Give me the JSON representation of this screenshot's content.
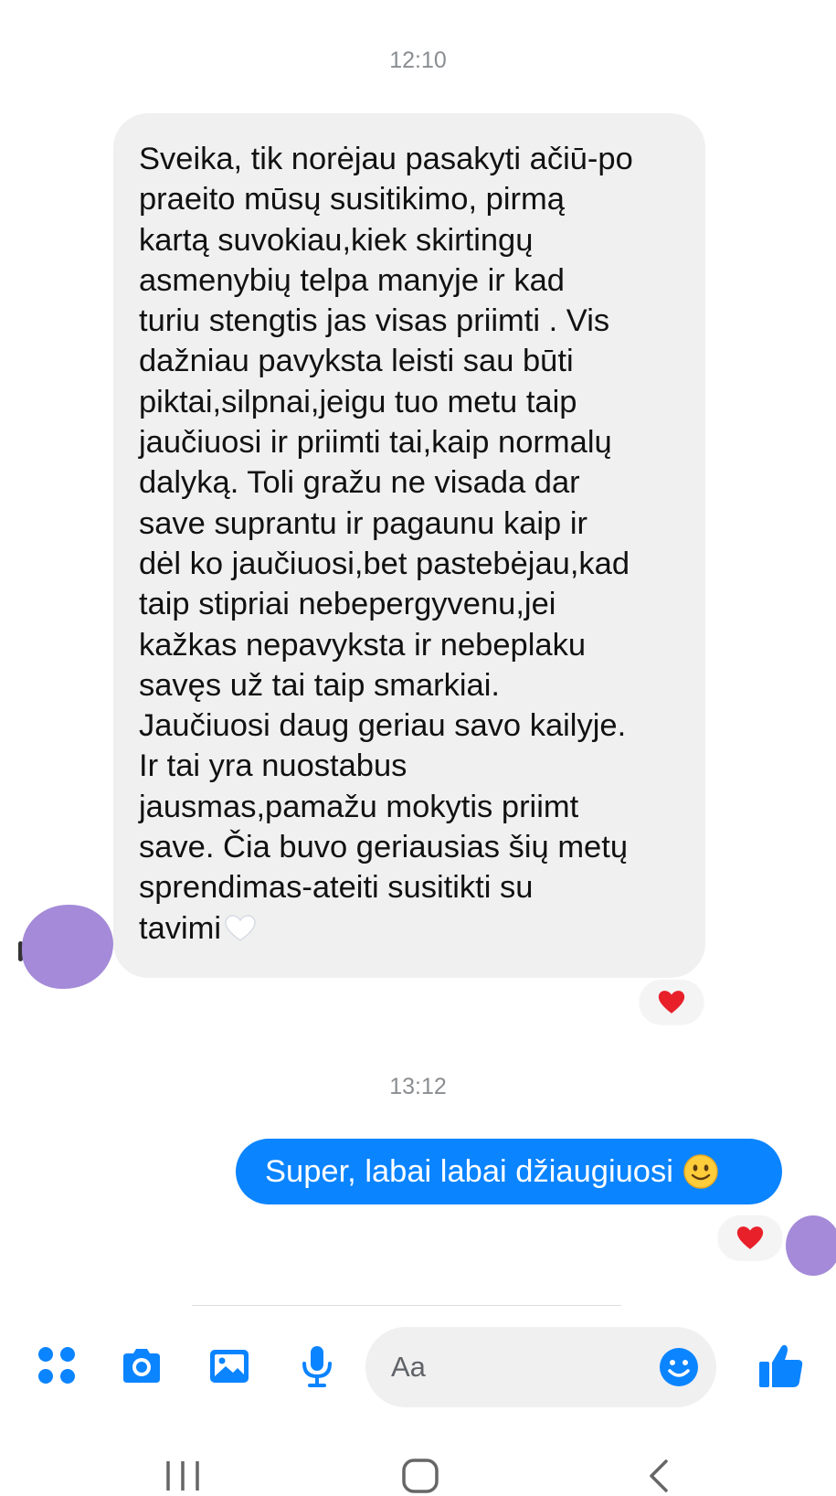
{
  "conversation": {
    "timestamp_1": "12:10",
    "timestamp_2": "13:12",
    "incoming_message": {
      "lines": [
        "Sveika, tik norėjau pasakyti ačiū-po",
        "praeito mūsų susitikimo, pirmą",
        "kartą suvokiau,kiek skirtingų",
        "asmenybių telpa manyje ir kad",
        "turiu stengtis jas visas priimti . Vis",
        "dažniau pavyksta leisti sau būti",
        "piktai,silpnai,jeigu tuo metu taip",
        "jaučiuosi ir priimti tai,kaip normalų",
        "dalyką. Toli gražu ne visada dar",
        "save suprantu ir pagaunu kaip ir",
        "dėl ko jaučiuosi,bet pastebėjau,kad",
        "taip stipriai nebepergyvenu,jei",
        "kažkas nepavyksta ir nebeplaku",
        "savęs už tai taip smarkiai.",
        "Jaučiuosi daug geriau savo kailyje.",
        "Ir tai yra nuostabus",
        "jausmas,pamažu mokytis priimt",
        "save. Čia buvo geriausias šių metų",
        "sprendimas-ateiti susitikti su",
        "tavimi"
      ],
      "trailing_emoji": "white-heart-emoji",
      "reaction": "red-heart-icon"
    },
    "outgoing_message": {
      "text": "Super, labai labai džiaugiuosi",
      "trailing_emoji": "smiling-face-emoji",
      "reaction": "red-heart-icon"
    }
  },
  "composer": {
    "placeholder": "Aa",
    "icons": [
      "apps-icon",
      "camera-icon",
      "gallery-icon",
      "microphone-icon",
      "emoji-icon",
      "thumbs-up-icon"
    ],
    "accent_color": "#0b84ff"
  },
  "navigation_bar": {
    "icons": [
      "recent-apps-icon",
      "home-icon",
      "back-icon"
    ]
  },
  "colors": {
    "incoming_bubble": "#f0f0f0",
    "outgoing_bubble": "#0b84ff",
    "avatar_redaction": "#a48ad8",
    "heart": "#e8202a"
  }
}
